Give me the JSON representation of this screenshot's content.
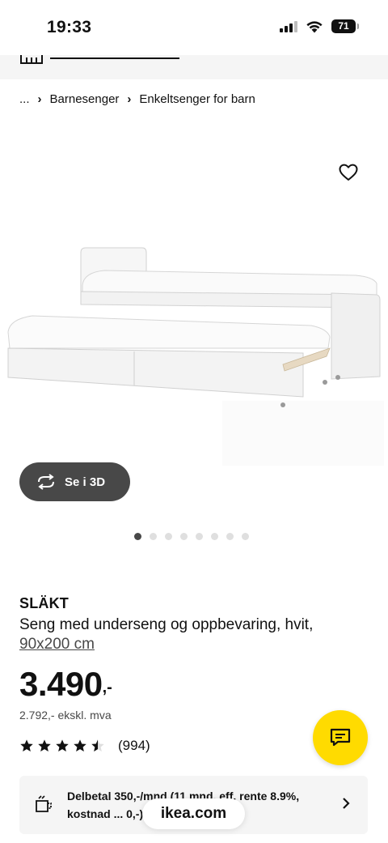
{
  "status_bar": {
    "time": "19:33",
    "battery": "71"
  },
  "breadcrumb": {
    "ellipsis": "...",
    "items": [
      "Barnesenger",
      "Enkeltsenger for barn"
    ]
  },
  "view_3d": {
    "label": "Se i 3D"
  },
  "carousel": {
    "count": 8,
    "active_index": 0
  },
  "product": {
    "name": "SLÄKT",
    "description": "Seng med underseng og oppbevaring, hvit,",
    "size": "90x200 cm",
    "price": "3.490",
    "price_suffix": ",-",
    "price_ex_vat": "2.792,- ekskl. mva"
  },
  "rating": {
    "stars": 4.5,
    "max": 5,
    "count": "(994)"
  },
  "financing": {
    "text": "Delbetal 350,-/mnd (11 mnd, eff. rente 8.9%, kostnad ... 0,-)."
  },
  "browser": {
    "url": "ikea.com"
  },
  "colors": {
    "brand_yellow": "#ffdb00",
    "dark_button": "#484848",
    "light_bg": "#f5f5f5"
  }
}
